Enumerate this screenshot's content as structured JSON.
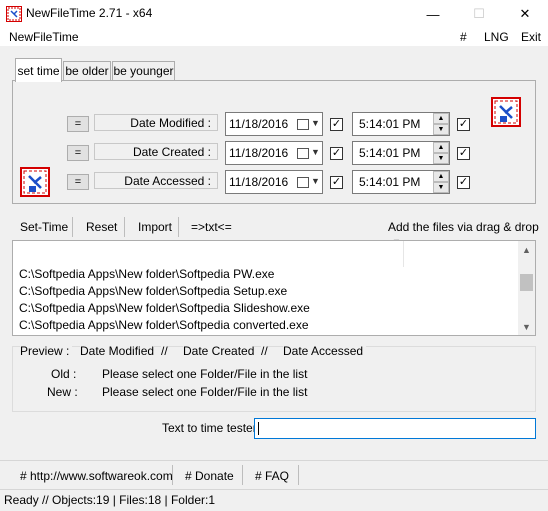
{
  "window": {
    "title": "NewFileTime 2.71 - x64",
    "minimize": "—",
    "maximize": "☐",
    "close": "✕"
  },
  "menu": {
    "app": "NewFileTime",
    "hash": "#",
    "lng": "LNG",
    "exit": "Exit"
  },
  "tabs": [
    "set time",
    "be older",
    "be younger"
  ],
  "rows": [
    {
      "eq": "=",
      "label": "Date Modified :",
      "date": "11/18/2016",
      "time": "5:14:01 PM"
    },
    {
      "eq": "=",
      "label": "Date Created :",
      "date": "11/18/2016",
      "time": "5:14:01 PM"
    },
    {
      "eq": "=",
      "label": "Date Accessed :",
      "date": "11/18/2016",
      "time": "5:14:01 PM"
    }
  ],
  "toolbar": {
    "set_time": "Set-Time",
    "reset": "Reset",
    "import": "Import",
    "txt": "=>txt<=",
    "add_files": "Add the files via drag & drop"
  },
  "files": [
    "C:\\Softpedia Apps\\New folder\\Softpedia PW.exe",
    "C:\\Softpedia Apps\\New folder\\Softpedia Setup.exe",
    "C:\\Softpedia Apps\\New folder\\Softpedia Slideshow.exe",
    "C:\\Softpedia Apps\\New folder\\Softpedia converted.exe"
  ],
  "preview": {
    "header": [
      "Preview  :",
      "Date Modified",
      "//",
      "Date Created",
      "//",
      "Date Accessed"
    ],
    "old_label": "Old :",
    "old_text": "Please select one Folder/File in the list",
    "new_label": "New :",
    "new_text": "Please select one Folder/File in the list"
  },
  "tester": {
    "label": "Text to time tester",
    "value": ""
  },
  "footer": {
    "website": "# http://www.softwareok.com",
    "donate": "# Donate",
    "faq": "# FAQ"
  },
  "status": "Ready // Objects:19 | Files:18  | Folder:1",
  "colors": {
    "accent": "#0078d7",
    "icon_red": "#d40000",
    "icon_blue": "#1c4fc9"
  }
}
